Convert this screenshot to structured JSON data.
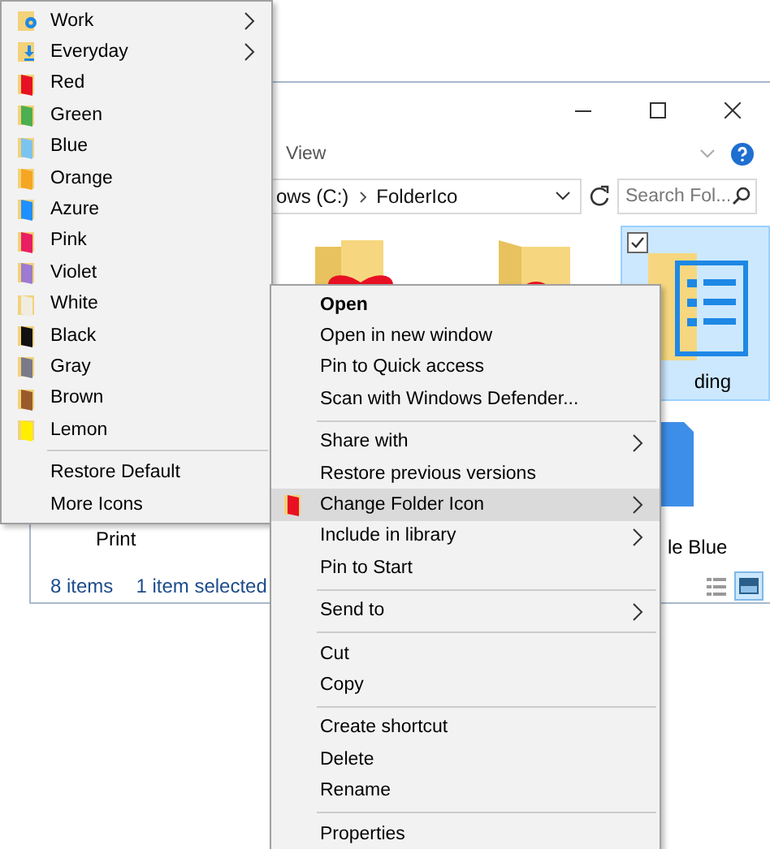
{
  "ribbon": {
    "tab": "View"
  },
  "address_bar": {
    "path": [
      "ows (C:)",
      "FolderIco"
    ]
  },
  "search": {
    "placeholder": "Search Fol..."
  },
  "rows": [
    [
      {
        "kind": "heart-folder"
      },
      {
        "kind": "badge-folder"
      },
      {
        "kind": "list-folder",
        "selected": true,
        "checked": true,
        "label": "ding"
      }
    ],
    [
      {
        "kind": "label-only",
        "label": "Print"
      },
      {
        "kind": "blue-folder",
        "label": "le Blue"
      }
    ]
  ],
  "status_bar": {
    "count": "8 items",
    "selection": "1 item selected"
  },
  "view_buttons": [
    {
      "kind": "details",
      "selected": false
    },
    {
      "kind": "large-icons",
      "selected": true
    }
  ],
  "icon_menu": {
    "items": [
      {
        "label": "Work",
        "kind": "gear-folder",
        "submenu": true
      },
      {
        "label": "Everyday",
        "kind": "download-folder",
        "submenu": true
      },
      {
        "label": "Red",
        "kind": "color",
        "color": "#e81123",
        "submenu": false
      },
      {
        "label": "Green",
        "kind": "color",
        "color": "#4caf50",
        "submenu": false
      },
      {
        "label": "Blue",
        "kind": "color",
        "color": "#7cc4f0",
        "submenu": false
      },
      {
        "label": "Orange",
        "kind": "color",
        "color": "#f5a623",
        "submenu": false
      },
      {
        "label": "Azure",
        "kind": "color",
        "color": "#1e90ff",
        "submenu": false
      },
      {
        "label": "Pink",
        "kind": "color",
        "color": "#e91e63",
        "submenu": false
      },
      {
        "label": "Violet",
        "kind": "color",
        "color": "#9c7bd0",
        "submenu": false
      },
      {
        "label": "White",
        "kind": "color",
        "color": "#f0ece0",
        "submenu": false
      },
      {
        "label": "Black",
        "kind": "color",
        "color": "#111111",
        "submenu": false
      },
      {
        "label": "Gray",
        "kind": "color",
        "color": "#7a7a8a",
        "submenu": false
      },
      {
        "label": "Brown",
        "kind": "color",
        "color": "#9a5b2a",
        "submenu": false
      },
      {
        "label": "Lemon",
        "kind": "color",
        "color": "#ffee00",
        "submenu": false
      }
    ],
    "actions": [
      "Restore Default",
      "More Icons"
    ]
  },
  "context_menu": {
    "groups": [
      [
        {
          "label": "Open",
          "default": true,
          "submenu": false,
          "selected": false
        },
        {
          "label": "Open in new window",
          "default": false,
          "submenu": false,
          "selected": false
        },
        {
          "label": "Pin to Quick access",
          "default": false,
          "submenu": false,
          "selected": false
        },
        {
          "label": "Scan with Windows Defender...",
          "default": false,
          "submenu": false,
          "selected": false
        }
      ],
      [
        {
          "label": "Share with",
          "default": false,
          "submenu": true,
          "selected": false
        },
        {
          "label": "Restore previous versions",
          "default": false,
          "submenu": false,
          "selected": false
        },
        {
          "label": "Change Folder Icon",
          "default": false,
          "submenu": true,
          "selected": true,
          "icon": true
        },
        {
          "label": "Include in library",
          "default": false,
          "submenu": true,
          "selected": false
        },
        {
          "label": "Pin to Start",
          "default": false,
          "submenu": false,
          "selected": false
        }
      ],
      [
        {
          "label": "Send to",
          "default": false,
          "submenu": true,
          "selected": false
        }
      ],
      [
        {
          "label": "Cut",
          "default": false,
          "submenu": false,
          "selected": false
        },
        {
          "label": "Copy",
          "default": false,
          "submenu": false,
          "selected": false
        }
      ],
      [
        {
          "label": "Create shortcut",
          "default": false,
          "submenu": false,
          "selected": false
        },
        {
          "label": "Delete",
          "default": false,
          "submenu": false,
          "selected": false
        },
        {
          "label": "Rename",
          "default": false,
          "submenu": false,
          "selected": false
        }
      ],
      [
        {
          "label": "Properties",
          "default": false,
          "submenu": false,
          "selected": false
        }
      ]
    ]
  }
}
